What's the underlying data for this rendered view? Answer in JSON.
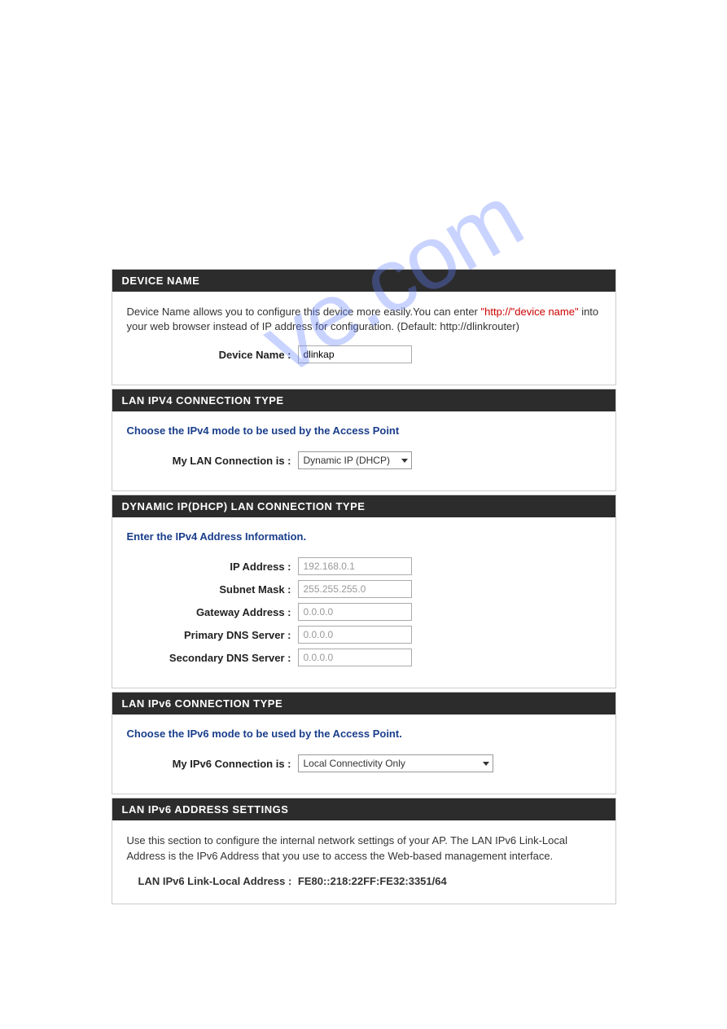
{
  "watermark": "ve.com",
  "device_name": {
    "header": "DEVICE NAME",
    "desc_pre": "Device Name allows you to configure this device more easily.You can enter ",
    "desc_red": "\"http://\"device name\"",
    "desc_post": " into your web browser instead of IP address for configuration. (Default: http://dlinkrouter)",
    "label": "Device Name :",
    "value": "dlinkap"
  },
  "ipv4_conn": {
    "header": "LAN IPV4 CONNECTION TYPE",
    "subhead": "Choose the IPv4 mode to be used by the Access Point",
    "label": "My LAN Connection is :",
    "selected": "Dynamic IP (DHCP)"
  },
  "dhcp": {
    "header": "DYNAMIC IP(DHCP) LAN CONNECTION TYPE",
    "subhead": "Enter the IPv4 Address Information.",
    "ip_label": "IP Address :",
    "ip_value": "192.168.0.1",
    "mask_label": "Subnet Mask :",
    "mask_value": "255.255.255.0",
    "gw_label": "Gateway Address :",
    "gw_value": "0.0.0.0",
    "dns1_label": "Primary DNS Server :",
    "dns1_value": "0.0.0.0",
    "dns2_label": "Secondary DNS Server :",
    "dns2_value": "0.0.0.0"
  },
  "ipv6_conn": {
    "header": "LAN IPv6 CONNECTION TYPE",
    "subhead": "Choose the IPv6 mode to be used by the Access Point.",
    "label": "My IPv6 Connection is :",
    "selected": "Local Connectivity Only"
  },
  "ipv6_addr": {
    "header": "LAN IPv6 ADDRESS SETTINGS",
    "desc": "Use this section to configure the internal network settings of your AP. The LAN IPv6 Link-Local Address is the IPv6 Address that you use to access the Web-based management interface.",
    "label": "LAN IPv6 Link-Local Address :",
    "value": "FE80::218:22FF:FE32:3351/64"
  }
}
